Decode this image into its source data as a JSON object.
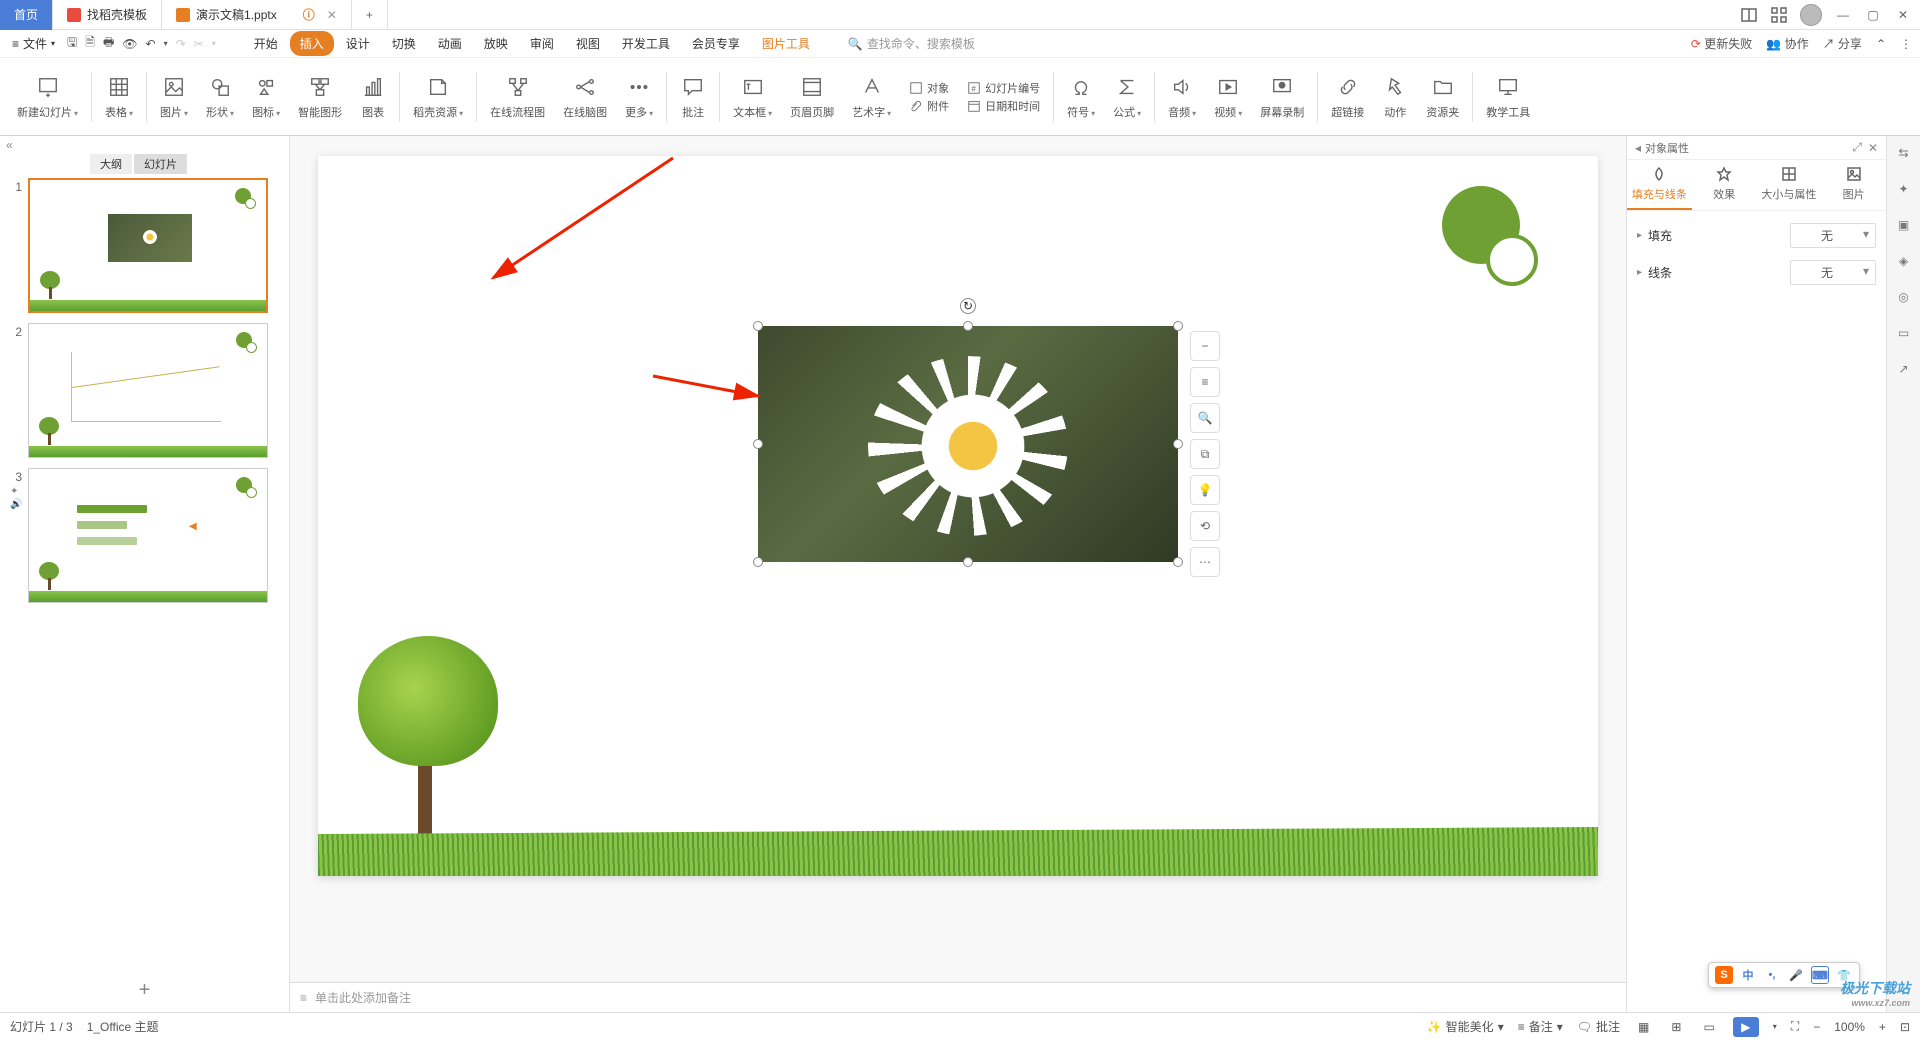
{
  "tabs": {
    "home": "首页",
    "docao": "找稻壳模板",
    "ppt": "演示文稿1.pptx",
    "new": "+"
  },
  "menu": {
    "file": "文件",
    "tabs": [
      "开始",
      "插入",
      "设计",
      "切换",
      "动画",
      "放映",
      "审阅",
      "视图",
      "开发工具",
      "会员专享"
    ],
    "active_index": 1,
    "context_tab": "图片工具",
    "search_icon": "Q",
    "search_placeholder": "查找命令、搜索模板"
  },
  "menu_right": {
    "update_fail": "更新失败",
    "coop": "协作",
    "share": "分享"
  },
  "ribbon": {
    "new_slide": "新建幻灯片",
    "table": "表格",
    "picture": "图片",
    "shape": "形状",
    "icon": "图标",
    "smart": "智能图形",
    "chart": "图表",
    "docao_res": "稻壳资源",
    "flow": "在线流程图",
    "mindmap": "在线脑图",
    "more": "更多",
    "note": "批注",
    "textbox": "文本框",
    "headerfooter": "页眉页脚",
    "wordart": "艺术字",
    "object": "对象",
    "attach": "附件",
    "slidenum": "幻灯片编号",
    "datetime": "日期和时间",
    "symbol": "符号",
    "formula": "公式",
    "audio": "音频",
    "video": "视频",
    "screenrec": "屏幕录制",
    "hyperlink": "超链接",
    "action": "动作",
    "respack": "资源夹",
    "teaching": "教学工具"
  },
  "left_panel": {
    "tab_outline": "大纲",
    "tab_slides": "幻灯片",
    "thumbs": [
      "1",
      "2",
      "3"
    ]
  },
  "notes_placeholder": "单击此处添加备注",
  "right_panel": {
    "title": "对象属性",
    "tabs": [
      "填充与线条",
      "效果",
      "大小与属性",
      "图片"
    ],
    "fill_label": "填充",
    "line_label": "线条",
    "none": "无"
  },
  "status": {
    "slide_pos": "幻灯片 1 / 3",
    "theme": "1_Office 主题",
    "beautify": "智能美化",
    "remarks": "备注",
    "annotate": "批注",
    "zoom": "100%"
  },
  "watermark": {
    "name": "极光下载站",
    "url": "www.xz7.com"
  }
}
